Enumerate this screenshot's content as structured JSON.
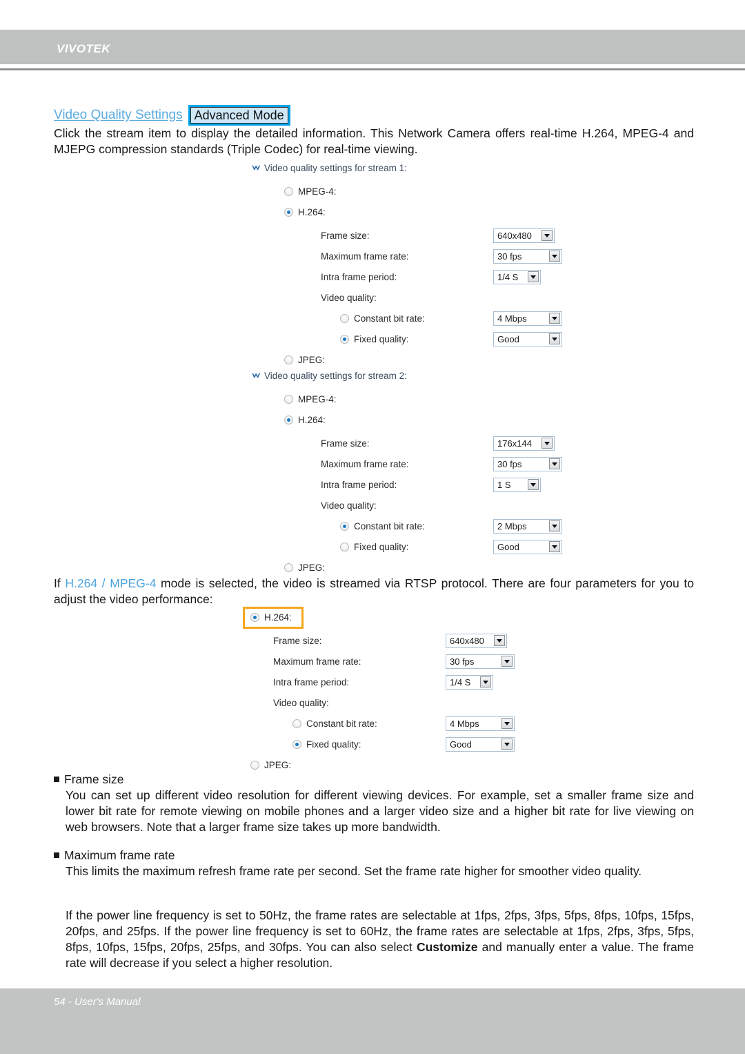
{
  "header": {
    "brand": "VIVOTEK"
  },
  "footer": {
    "page_label": "54 - User's Manual"
  },
  "section": {
    "title": "Video Quality Settings",
    "badge": "Advanced Mode",
    "intro": "Click the stream item to display the detailed information. This Network Camera offers real-time H.264, MPEG-4 and MJEPG compression standards (Triple Codec) for real-time viewing."
  },
  "rtsp_paragraph": {
    "lead": "If ",
    "accent": "H.264 / MPEG-4",
    "rest": " mode is selected, the video is streamed via RTSP protocol. There are four parameters for you to adjust the video performance:"
  },
  "icons": {
    "collapse": "double-chevron-down-icon",
    "dropdown": "chevron-down-icon",
    "bullet": "square-bullet-icon"
  },
  "stream1": {
    "title": "Video quality settings for stream 1:",
    "codecs": [
      {
        "label": "MPEG-4:",
        "checked": false
      },
      {
        "label": "H.264:",
        "checked": true
      },
      {
        "label": "JPEG:",
        "checked": false
      }
    ],
    "fields": [
      {
        "label": "Frame size:",
        "value": "640x480"
      },
      {
        "label": "Maximum frame rate:",
        "value": "30 fps"
      },
      {
        "label": "Intra frame period:",
        "value": "1/4 S"
      }
    ],
    "quality_label": "Video quality:",
    "quality_options": [
      {
        "label": "Constant bit rate:",
        "checked": false,
        "value": "4 Mbps"
      },
      {
        "label": "Fixed quality:",
        "checked": true,
        "value": "Good"
      }
    ]
  },
  "stream2": {
    "title": "Video quality settings for stream 2:",
    "codecs": [
      {
        "label": "MPEG-4:",
        "checked": false
      },
      {
        "label": "H.264:",
        "checked": true
      },
      {
        "label": "JPEG:",
        "checked": false
      }
    ],
    "fields": [
      {
        "label": "Frame size:",
        "value": "176x144"
      },
      {
        "label": "Maximum frame rate:",
        "value": "30 fps"
      },
      {
        "label": "Intra frame period:",
        "value": "1 S"
      }
    ],
    "quality_label": "Video quality:",
    "quality_options": [
      {
        "label": "Constant bit rate:",
        "checked": true,
        "value": "2 Mbps"
      },
      {
        "label": "Fixed quality:",
        "checked": false,
        "value": "Good"
      }
    ]
  },
  "detail_figure": {
    "codec_label": "H.264:",
    "codec_checked": true,
    "jpeg_label": "JPEG:",
    "fields": [
      {
        "label": "Frame size:",
        "value": "640x480"
      },
      {
        "label": "Maximum frame rate:",
        "value": "30 fps"
      },
      {
        "label": "Intra frame period:",
        "value": "1/4 S"
      }
    ],
    "quality_label": "Video quality:",
    "quality_options": [
      {
        "label": "Constant bit rate:",
        "checked": false,
        "value": "4 Mbps"
      },
      {
        "label": "Fixed quality:",
        "checked": true,
        "value": "Good"
      }
    ]
  },
  "bullets": [
    {
      "heading": "Frame size",
      "body": "You can set up different video resolution for different viewing devices. For example, set a smaller frame size and lower bit rate for remote viewing on mobile phones and a larger video size and a higher bit rate for live viewing on web browsers. Note that a larger frame size takes up more bandwidth."
    },
    {
      "heading": "Maximum frame rate",
      "body": "This limits the maximum refresh frame rate per second. Set the frame rate higher for smoother video quality."
    }
  ],
  "frame_rate_note": {
    "part1": "If the power line frequency is set to 50Hz, the frame rates are selectable at 1fps, 2fps, 3fps, 5fps, 8fps, 10fps, 15fps, 20fps, and 25fps. If the power line frequency is set to 60Hz, the frame rates are selectable at 1fps, 2fps, 3fps, 5fps, 8fps, 10fps, 15fps, 20fps, 25fps, and 30fps. You can also select ",
    "bold": "Customize",
    "part2": " and manually enter a value. The frame rate will decrease if you select a higher resolution."
  },
  "colors": {
    "accent_blue": "#4aa3dd",
    "badge_border": "#00a3e6",
    "badge_fill": "#cfe7f7",
    "highlight_orange": "#f5a71b",
    "bar_gray": "#bfc1c1"
  }
}
